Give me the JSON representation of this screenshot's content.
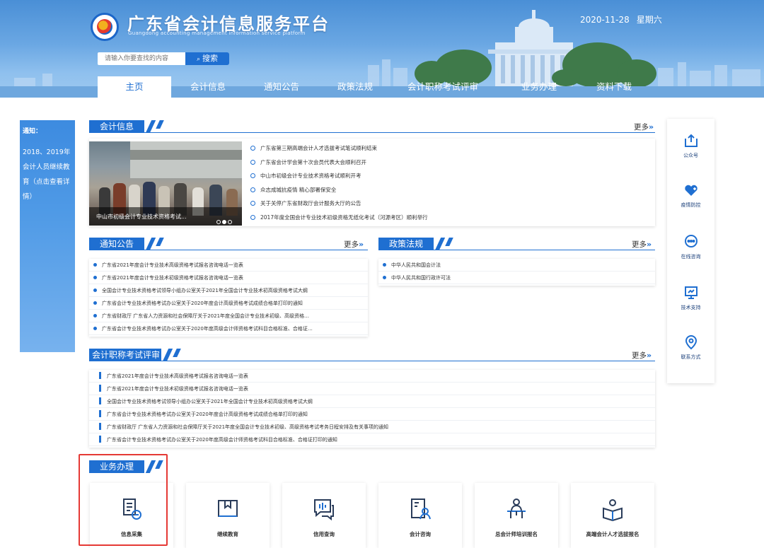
{
  "header": {
    "title": "广东省会计信息服务平台",
    "subtitle": "Guangdong accounting management information service platform",
    "date": "2020-11-28",
    "weekday": "星期六"
  },
  "search": {
    "placeholder": "请输入你要查找的内容",
    "button": "搜索"
  },
  "nav": {
    "items": [
      "主页",
      "会计信息",
      "通知公告",
      "政策法规",
      "会计职称考试评审",
      "业务办理",
      "资料下载"
    ]
  },
  "notice": {
    "title": "通知：",
    "body": "2018、2019年会计人员继续教育（点击查看详情）"
  },
  "more_label": "更多",
  "sections": {
    "accounting_info": {
      "title": "会计信息",
      "photo_caption": "中山市初级会计专业技术资格考试...",
      "items": [
        "广东省第三期高端会计人才选拔考试笔试顺利结束",
        "广东省会计学会第十次会员代表大会顺利召开",
        "中山市初级会计专业技术资格考试顺利开考",
        "众志成城抗疫情 精心部署保安全",
        "关于关停广东省财政厅会计服务大厅的公告",
        "2017年度全国会计专业技术初级资格无纸化考试（河源考区）顺利举行"
      ]
    },
    "notices": {
      "title": "通知公告",
      "items": [
        "广东省2021年度会计专业技术高级资格考试报名咨询电话一览表",
        "广东省2021年度会计专业技术初级资格考试报名咨询电话一览表",
        "全国会计专业技术资格考试领导小组办公室关于2021年全国会计专业技术初高级资格考试大纲",
        "广东省会计专业技术资格考试办公室关于2020年度会计高级资格考试成绩合格单打印的通知",
        "广东省财政厅 广东省人力资源和社会保障厅关于2021年度全国会计专业技术初级、高级资格…",
        "广东省会计专业技术资格考试办公室关于2020年度高级会计师资格考试科目合格标准、合格证…"
      ]
    },
    "policy": {
      "title": "政策法规",
      "items": [
        "中华人民共和国会计法",
        "中华人民共和国行政许可法"
      ]
    },
    "exam": {
      "title": "会计职称考试评审",
      "items": [
        "广东省2021年度会计专业技术高级资格考试报名咨询电话一览表",
        "广东省2021年度会计专业技术初级资格考试报名咨询电话一览表",
        "全国会计专业技术资格考试领导小组办公室关于2021年全国会计专业技术初高级资格考试大纲",
        "广东省会计专业技术资格考试办公室关于2020年度会计高级资格考试成绩合格单打印的通知",
        "广东省财政厅 广东省人力资源和社会保障厅关于2021年度全国会计专业技术初级、高级资格考试考务日程安排及有关事项的通知",
        "广东省会计专业技术资格考试办公室关于2020年度高级会计师资格考试科目合格标准、合格证打印的通知"
      ]
    },
    "business": {
      "title": "业务办理",
      "tiles": [
        "信息采集",
        "继续教育",
        "信用查询",
        "会计咨询",
        "总会计师培训报名",
        "高端会计人才选拔报名"
      ]
    }
  },
  "sidebar": {
    "items": [
      {
        "label": "公众号",
        "icon": "upload-icon"
      },
      {
        "label": "疫情防控",
        "icon": "heart-icon"
      },
      {
        "label": "在线咨询",
        "icon": "chat-icon"
      },
      {
        "label": "技术支持",
        "icon": "monitor-icon"
      },
      {
        "label": "联系方式",
        "icon": "location-icon"
      }
    ]
  },
  "colors": {
    "primary": "#1f6fd1",
    "highlight": "#e53935"
  }
}
